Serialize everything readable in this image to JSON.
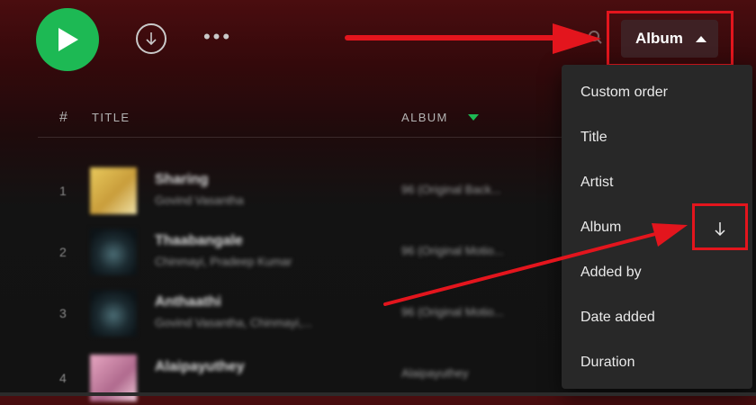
{
  "toolbar": {
    "play_icon": "play-icon",
    "download_icon": "download-icon",
    "more_label": "•••",
    "search_icon": "search-icon",
    "sort_button_label": "Album"
  },
  "tracklist": {
    "header": {
      "number": "#",
      "title": "TITLE",
      "album": "ALBUM"
    },
    "rows": [
      {
        "number": "1",
        "title": "Sharing",
        "artist": "Govind Vasantha",
        "album": "96 (Original Back..."
      },
      {
        "number": "2",
        "title": "Thaabangale",
        "artist": "Chinmayi, Pradeep Kumar",
        "album": "96 (Original Motio..."
      },
      {
        "number": "3",
        "title": "Anthaathi",
        "artist": "Govind Vasantha, Chinmayi,...",
        "album": "96 (Original Motio..."
      },
      {
        "number": "4",
        "title": "Alaipayuthey",
        "artist": "",
        "album": "Alaipayuthey"
      }
    ]
  },
  "sort_menu": {
    "items": [
      "Custom order",
      "Title",
      "Artist",
      "Album",
      "Added by",
      "Date added",
      "Duration"
    ],
    "selected": "Album",
    "direction_icon": "arrow-down-icon"
  },
  "colors": {
    "accent": "#1db954",
    "annotation": "#e3151d",
    "menu_bg": "#282828"
  }
}
